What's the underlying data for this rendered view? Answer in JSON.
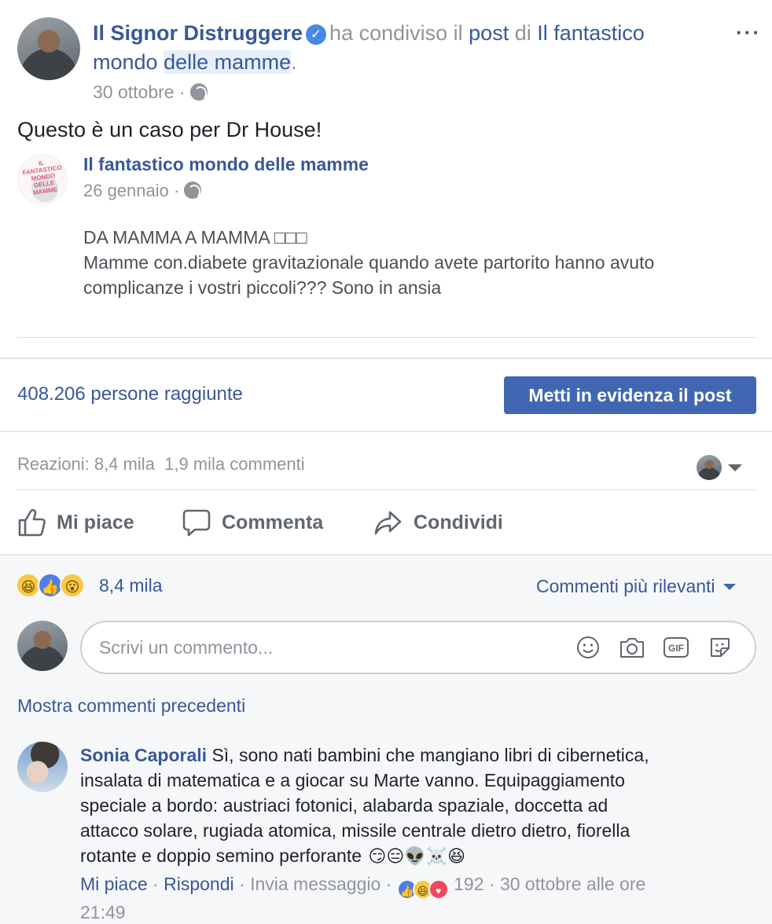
{
  "post": {
    "author": "Il Signor Distruggere",
    "shared_text_1": "ha condiviso il",
    "post_word": "post",
    "of_word": "di",
    "page_line1": "Il fantastico",
    "page_line2a": "mondo",
    "page_line2b": "delle mamme",
    "dot": ".",
    "date": "30 ottobre",
    "sep": "·",
    "more_icon": "···",
    "message": "Questo è un caso per Dr House!"
  },
  "shared_post": {
    "page_name": "Il fantastico mondo delle mamme",
    "avatar_text": "IL FANTASTICO MONDO DELLE MAMME",
    "date": "26 gennaio",
    "line1": "DA MAMMA A MAMMA □□□",
    "line2": "Mamme con.diabete gravitazionale quando avete partorito hanno avuto",
    "line3": "complicanze i vostri piccoli??? Sono in ansia"
  },
  "insights": {
    "reach": "408.206 persone raggiunte",
    "boost_label": "Metti in evidenza il post"
  },
  "stats": {
    "reactions": "Reazioni: 8,4 mila",
    "comments": "1,9 mila commenti"
  },
  "actions": {
    "like": "Mi piace",
    "comment": "Commenta",
    "share": "Condividi"
  },
  "reactions_bar": {
    "count": "8,4 mila",
    "sort_label": "Commenti più rilevanti"
  },
  "composer": {
    "placeholder": "Scrivi un commento..."
  },
  "older_comments": "Mostra commenti precedenti",
  "comment": {
    "author": "Sonia Caporali",
    "line1": "Sì, sono nati bambini che mangiano libri di cibernetica,",
    "line2": "insalata di matematica e a giocar su Marte vanno. Equipaggiamento",
    "line3": "speciale a bordo: austriaci fotonici, alabarda spaziale, doccetta ad",
    "line4": "attacco solare, rugiada atomica, missile centrale dietro dietro, fiorella",
    "line5": "rotante e doppio semino perforante",
    "emojis": "😏😑👽☠️😆",
    "like": "Mi piace",
    "reply": "Rispondi",
    "message": "Invia messaggio",
    "reaction_count": "192",
    "timestamp_a": "30 ottobre alle ore",
    "timestamp_b": "21:49"
  },
  "colors": {
    "link": "#385898",
    "button": "#4267b2",
    "meta": "#90949c"
  }
}
